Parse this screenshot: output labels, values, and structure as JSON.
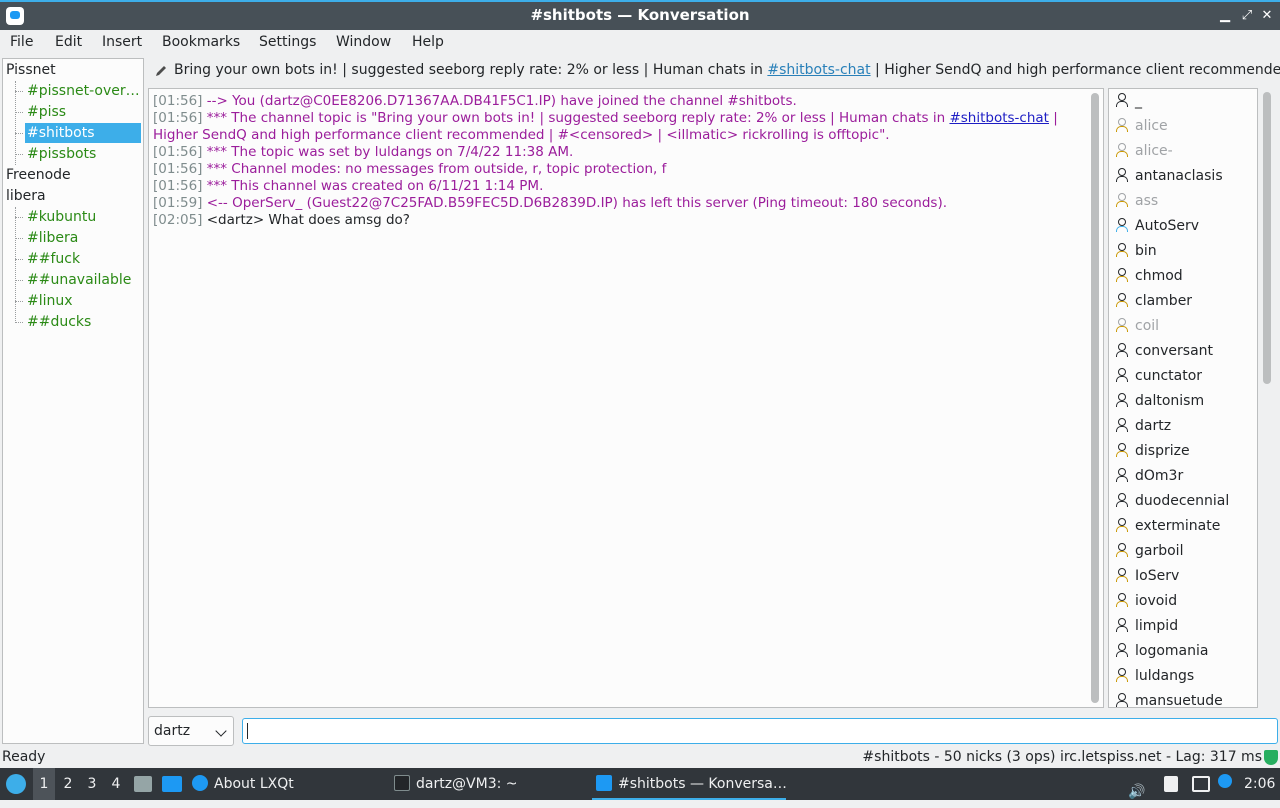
{
  "window": {
    "title": "#shitbots — Konversation"
  },
  "menu": [
    "File",
    "Edit",
    "Insert",
    "Bookmarks",
    "Settings",
    "Window",
    "Help"
  ],
  "sidebar": {
    "networks": [
      {
        "name": "Pissnet",
        "channels": [
          "#pissnet-over…",
          "#piss",
          "#shitbots",
          "#pissbots"
        ]
      },
      {
        "name": "Freenode",
        "channels": []
      },
      {
        "name": "libera",
        "channels": [
          "#kubuntu",
          "#libera",
          "##fuck",
          "##unavailable",
          "#linux",
          "##ducks"
        ]
      }
    ],
    "selected": "#shitbots"
  },
  "topic": {
    "part1": "Bring your own bots in! | suggested seeborg reply rate: 2% or less | Human chats in ",
    "link": "#shitbots-chat",
    "part2": " | Higher SendQ and high performance client recommended | ..."
  },
  "chat": {
    "lines": [
      {
        "ts": "[01:56]",
        "text": "--> You (dartz@C0EE8206.D71367AA.DB41F5C1.IP) have joined the channel #shitbots."
      },
      {
        "ts": "[01:56]",
        "text": "*** The channel topic is \"Bring your own bots in! | suggested seeborg reply rate: 2% or less | Human chats in ",
        "link": "#shitbots-chat",
        "after": " |"
      },
      {
        "ts": "",
        "text": "Higher SendQ and high performance client recommended | #<censored> | <illmatic> rickrolling is offtopic\"."
      },
      {
        "ts": "[01:56]",
        "text": "*** The topic was set by luldangs on 7/4/22 11:38 AM."
      },
      {
        "ts": "[01:56]",
        "text": "*** Channel modes: no messages from outside, r, topic protection, f"
      },
      {
        "ts": "[01:56]",
        "text": "*** This channel was created on 6/11/21 1:14 PM."
      },
      {
        "ts": "[01:59]",
        "text": "<-- OperServ_ (Guest22@7C25FAD.B59FEC5D.D6B2839D.IP) has left this server (Ping timeout: 180 seconds)."
      },
      {
        "ts": "[02:05]",
        "text": "<dartz> What does amsg do?"
      }
    ]
  },
  "nicks": [
    {
      "name": "_",
      "state": "normal"
    },
    {
      "name": "alice",
      "state": "away-op"
    },
    {
      "name": "alice-",
      "state": "away-op"
    },
    {
      "name": "antanaclasis",
      "state": "normal"
    },
    {
      "name": "ass",
      "state": "away-op"
    },
    {
      "name": "AutoServ",
      "state": "voice"
    },
    {
      "name": "bin",
      "state": "op"
    },
    {
      "name": "chmod",
      "state": "op"
    },
    {
      "name": "clamber",
      "state": "op"
    },
    {
      "name": "coil",
      "state": "away-op"
    },
    {
      "name": "conversant",
      "state": "normal"
    },
    {
      "name": "cunctator",
      "state": "normal"
    },
    {
      "name": "daltonism",
      "state": "normal"
    },
    {
      "name": "dartz",
      "state": "normal"
    },
    {
      "name": "disprize",
      "state": "op"
    },
    {
      "name": "dOm3r",
      "state": "normal"
    },
    {
      "name": "duodecennial",
      "state": "normal"
    },
    {
      "name": "exterminate",
      "state": "op"
    },
    {
      "name": "garboil",
      "state": "op"
    },
    {
      "name": "IoServ",
      "state": "op"
    },
    {
      "name": "iovoid",
      "state": "op"
    },
    {
      "name": "limpid",
      "state": "normal"
    },
    {
      "name": "logomania",
      "state": "normal"
    },
    {
      "name": "luldangs",
      "state": "op"
    },
    {
      "name": "mansuetude",
      "state": "normal"
    }
  ],
  "input": {
    "nick": "dartz",
    "value": ""
  },
  "status": {
    "left": "Ready",
    "right": "#shitbots - 50 nicks (3 ops)  irc.letspiss.net - Lag: 317 ms"
  },
  "taskbar": {
    "desktops": [
      "1",
      "2",
      "3",
      "4"
    ],
    "tasks": [
      "About LXQt",
      "dartz@VM3: ~",
      "#shitbots — Konversa…"
    ],
    "clock": "2:06"
  },
  "colors": {
    "accent": "#3daee9",
    "channel": "#2b8a16",
    "server_msg": "#9b1d9b"
  }
}
